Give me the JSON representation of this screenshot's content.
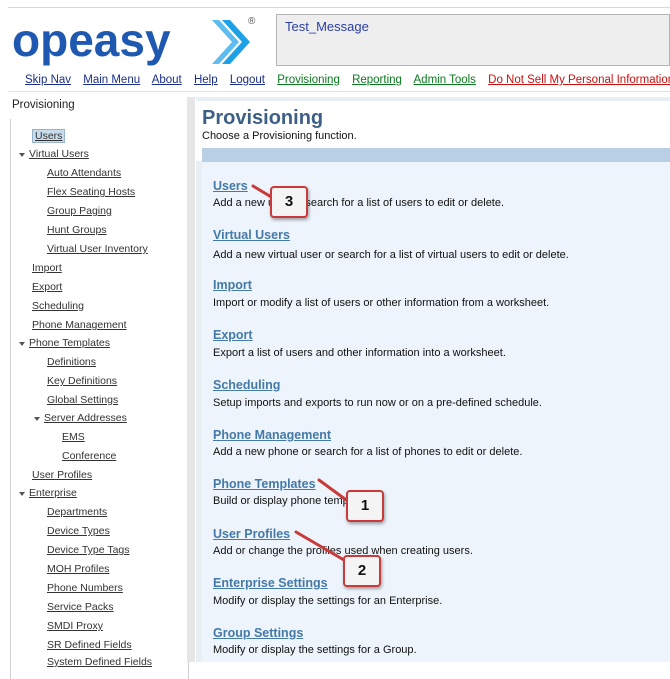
{
  "brand": {
    "logo_text": "opeasy",
    "registered_mark": "®"
  },
  "message_box": {
    "text": "Test_Message"
  },
  "top_nav": [
    {
      "label": "Skip Nav",
      "color": "dark"
    },
    {
      "label": "Main Menu",
      "color": "dark"
    },
    {
      "label": "About",
      "color": "dark"
    },
    {
      "label": "Help",
      "color": "dark"
    },
    {
      "label": "Logout",
      "color": "dark"
    },
    {
      "label": "Provisioning",
      "color": "green"
    },
    {
      "label": "Reporting",
      "color": "green"
    },
    {
      "label": "Admin Tools",
      "color": "green"
    },
    {
      "label": "Do Not Sell My Personal Information",
      "color": "red"
    }
  ],
  "sidebar": {
    "header": "Provisioning",
    "items": [
      {
        "label": "Users",
        "level": 1,
        "selected": true
      },
      {
        "label": "Virtual Users",
        "level": 0,
        "expanded": true
      },
      {
        "label": "Auto Attendants",
        "level": 2
      },
      {
        "label": "Flex Seating Hosts",
        "level": 2
      },
      {
        "label": "Group Paging",
        "level": 2
      },
      {
        "label": "Hunt Groups",
        "level": 2
      },
      {
        "label": "Virtual User Inventory",
        "level": 2
      },
      {
        "label": "Import",
        "level": 1
      },
      {
        "label": "Export",
        "level": 1
      },
      {
        "label": "Scheduling",
        "level": 1
      },
      {
        "label": "Phone Management",
        "level": 1
      },
      {
        "label": "Phone Templates",
        "level": 0,
        "expanded": true
      },
      {
        "label": "Definitions",
        "level": 2
      },
      {
        "label": "Key Definitions",
        "level": 2
      },
      {
        "label": "Global Settings",
        "level": 2
      },
      {
        "label": "Server Addresses",
        "level": 1.5,
        "expanded": true
      },
      {
        "label": "EMS",
        "level": 3
      },
      {
        "label": "Conference",
        "level": 3
      },
      {
        "label": "User Profiles",
        "level": 1
      },
      {
        "label": "Enterprise",
        "level": 0,
        "expanded": true
      },
      {
        "label": "Departments",
        "level": 2
      },
      {
        "label": "Device Types",
        "level": 2
      },
      {
        "label": "Device Type Tags",
        "level": 2
      },
      {
        "label": "MOH Profiles",
        "level": 2
      },
      {
        "label": "Phone Numbers",
        "level": 2
      },
      {
        "label": "Service Packs",
        "level": 2
      },
      {
        "label": "SMDI Proxy",
        "level": 2
      },
      {
        "label": "SR Defined Fields",
        "level": 2
      },
      {
        "label": "System Defined Fields",
        "level": 2
      }
    ]
  },
  "main": {
    "title": "Provisioning",
    "subtitle": "Choose a Provisioning function.",
    "functions": [
      {
        "label": "Users",
        "desc": "Add a new user or search for a list of users to edit or delete."
      },
      {
        "label": "Virtual Users",
        "desc": "Add a new virtual user or search for a list of virtual users to edit or delete."
      },
      {
        "label": "Import",
        "desc": "Import or modify a list of users or other information from a worksheet."
      },
      {
        "label": "Export",
        "desc": "Export a list of users and other information into a worksheet."
      },
      {
        "label": "Scheduling",
        "desc": "Setup imports and exports to run now or on a pre-defined schedule."
      },
      {
        "label": "Phone Management",
        "desc": "Add a new phone or search for a list of phones to edit or delete."
      },
      {
        "label": "Phone Templates",
        "desc": "Build or display phone templates."
      },
      {
        "label": "User Profiles",
        "desc": "Add or change the profiles used when creating users."
      },
      {
        "label": "Enterprise Settings",
        "desc": "Modify or display the settings for an Enterprise."
      },
      {
        "label": "Group Settings",
        "desc": "Modify or display the settings for a Group."
      }
    ]
  },
  "callouts": [
    "1",
    "2",
    "3"
  ],
  "colors": {
    "logo_blue": "#1e58b0",
    "logo_arrow": "#1ea0e6",
    "heading": "#3d5f86",
    "link": "#4479a8",
    "nav_green": "#0a7a1e",
    "nav_red": "#cc1010",
    "callout_border": "#c93a3a"
  }
}
